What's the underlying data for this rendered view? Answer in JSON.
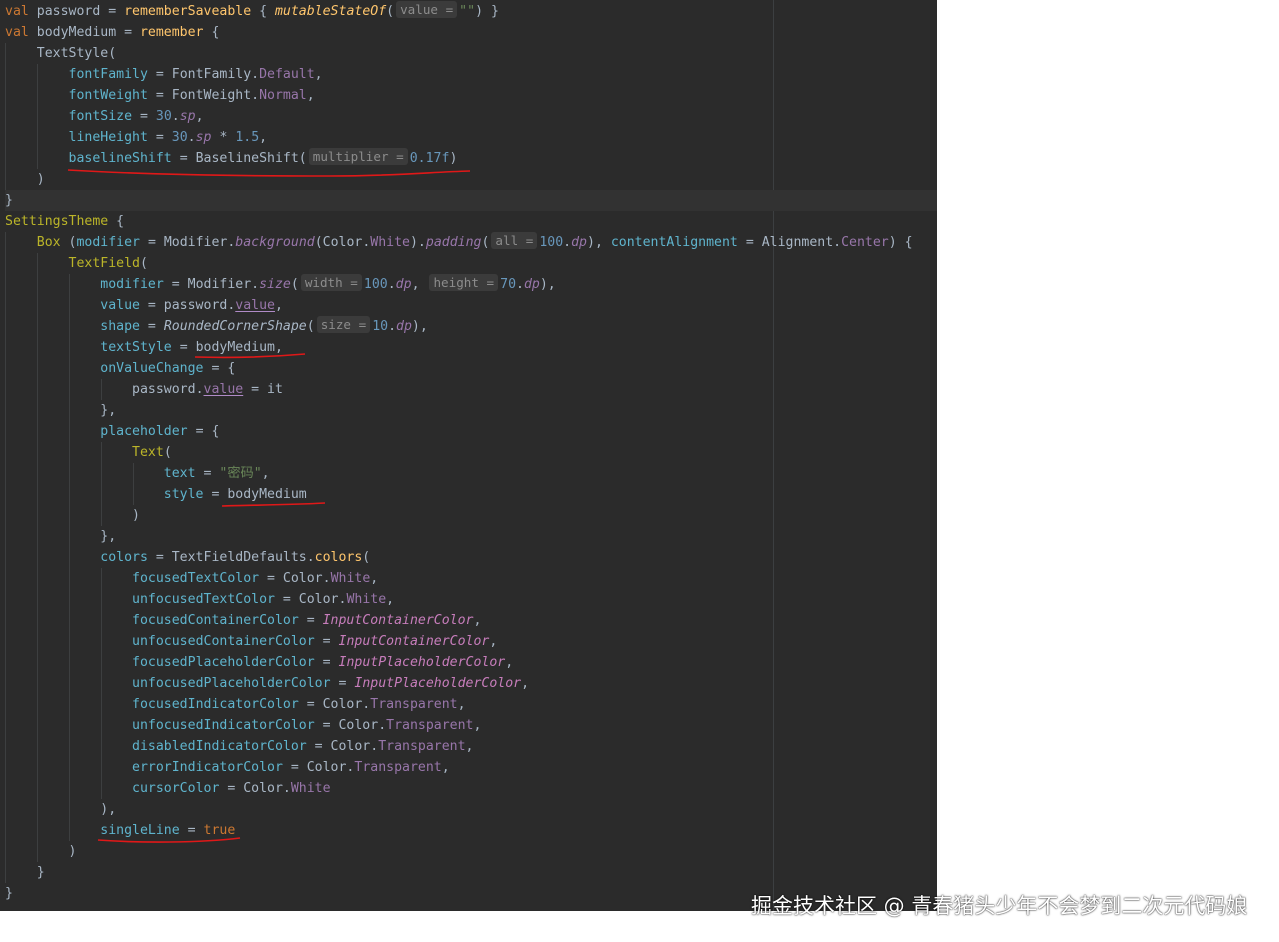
{
  "colors": {
    "editor_background": "#2b2b2b",
    "keyword": "#cc7832",
    "function": "#ffc66d",
    "parameter": "#5fb4cd",
    "number": "#6897bb",
    "string": "#6a8759",
    "member": "#9876aa",
    "annotation_mark": "#e01818"
  },
  "code": {
    "l01": {
      "k1": "val",
      "t1": " password = ",
      "f1": "rememberSaveable",
      "t2": " { ",
      "f2": "mutableStateOf",
      "t3": "(",
      "h1": "value =",
      "s1": "\"\"",
      "t4": ") }"
    },
    "l02": {
      "k1": "val",
      "t1": " bodyMedium = ",
      "f1": "remember",
      "t2": " {"
    },
    "l03": {
      "t1": "TextStyle("
    },
    "l04": {
      "p1": "fontFamily",
      "t1": " = FontFamily.",
      "m1": "Default",
      "t2": ","
    },
    "l05": {
      "p1": "fontWeight",
      "t1": " = FontWeight.",
      "m1": "Normal",
      "t2": ","
    },
    "l06": {
      "p1": "fontSize",
      "t1": " = ",
      "n1": "30",
      "t2": ".",
      "e1": "sp",
      "t3": ","
    },
    "l07": {
      "p1": "lineHeight",
      "t1": " = ",
      "n1": "30",
      "t2": ".",
      "e1": "sp",
      "t3": " * ",
      "n2": "1.5",
      "t4": ","
    },
    "l08": {
      "p1": "baselineShift",
      "t1": " = BaselineShift(",
      "h1": "multiplier =",
      "n1": "0.17f",
      "t2": ")"
    },
    "l09": {
      "t1": ")"
    },
    "l10": {
      "t1": "}"
    },
    "l11": {
      "c1": "SettingsTheme",
      "t1": " {"
    },
    "l12": {
      "c1": "Box",
      "t1": " (",
      "p1": "modifier",
      "t2": " = Modifier.",
      "e1": "background",
      "t3": "(Color.",
      "m1": "White",
      "t4": ").",
      "e2": "padding",
      "t5": "(",
      "h1": "all =",
      "n1": "100",
      "t6": ".",
      "e3": "dp",
      "t7": "), ",
      "p2": "contentAlignment",
      "t8": " = Alignment.",
      "m2": "Center",
      "t9": ") {"
    },
    "l13": {
      "c1": "TextField",
      "t1": "("
    },
    "l14": {
      "p1": "modifier",
      "t1": " = Modifier.",
      "e1": "size",
      "t2": "(",
      "h1": "width =",
      "n1": "100",
      "t3": ".",
      "e2": "dp",
      "t4": ", ",
      "h2": "height =",
      "n2": "70",
      "t5": ".",
      "e3": "dp",
      "t6": "),"
    },
    "l15": {
      "p1": "value",
      "t1": " = password.",
      "m1": "value",
      "t2": ","
    },
    "l16": {
      "p1": "shape",
      "t1": " = ",
      "f1": "RoundedCornerShape",
      "t2": "(",
      "h1": "size =",
      "n1": "10",
      "t3": ".",
      "e1": "dp",
      "t4": "),"
    },
    "l17": {
      "p1": "textStyle",
      "t1": " = bodyMedium,"
    },
    "l18": {
      "p1": "onValueChange",
      "t1": " = {"
    },
    "l19": {
      "t1": "password.",
      "m1": "value",
      "t2": " = it"
    },
    "l20": {
      "t1": "},"
    },
    "l21": {
      "p1": "placeholder",
      "t1": " = {"
    },
    "l22": {
      "c1": "Text",
      "t1": "("
    },
    "l23": {
      "p1": "text",
      "t1": " = ",
      "s1": "\"密码\"",
      "t2": ","
    },
    "l24": {
      "p1": "style",
      "t1": " = bodyMedium"
    },
    "l25": {
      "t1": ")"
    },
    "l26": {
      "t1": "},"
    },
    "l27": {
      "p1": "colors",
      "t1": " = TextFieldDefaults.",
      "f1": "colors",
      "t2": "("
    },
    "l28": {
      "p1": "focusedTextColor",
      "t1": " = Color.",
      "m1": "White",
      "t2": ","
    },
    "l29": {
      "p1": "unfocusedTextColor",
      "t1": " = Color.",
      "m1": "White",
      "t2": ","
    },
    "l30": {
      "p1": "focusedContainerColor",
      "t1": " = ",
      "v1": "InputContainerColor",
      "t2": ","
    },
    "l31": {
      "p1": "unfocusedContainerColor",
      "t1": " = ",
      "v1": "InputContainerColor",
      "t2": ","
    },
    "l32": {
      "p1": "focusedPlaceholderColor",
      "t1": " = ",
      "v1": "InputPlaceholderColor",
      "t2": ","
    },
    "l33": {
      "p1": "unfocusedPlaceholderColor",
      "t1": " = ",
      "v1": "InputPlaceholderColor",
      "t2": ","
    },
    "l34": {
      "p1": "focusedIndicatorColor",
      "t1": " = Color.",
      "m1": "Transparent",
      "t2": ","
    },
    "l35": {
      "p1": "unfocusedIndicatorColor",
      "t1": " = Color.",
      "m1": "Transparent",
      "t2": ","
    },
    "l36": {
      "p1": "disabledIndicatorColor",
      "t1": " = Color.",
      "m1": "Transparent",
      "t2": ","
    },
    "l37": {
      "p1": "errorIndicatorColor",
      "t1": " = Color.",
      "m1": "Transparent",
      "t2": ","
    },
    "l38": {
      "p1": "cursorColor",
      "t1": " = Color.",
      "m1": "White"
    },
    "l39": {
      "t1": "),"
    },
    "l40": {
      "p1": "singleLine",
      "t1": " = ",
      "k1": "true"
    },
    "l41": {
      "t1": ")"
    },
    "l42": {
      "t1": "}"
    },
    "l43": {
      "t1": "}"
    }
  },
  "watermark": {
    "text": "掘金技术社区 @ 青春猪头少年不会梦到二次元代码娘"
  }
}
